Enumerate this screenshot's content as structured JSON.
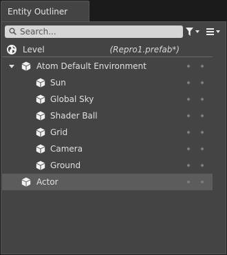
{
  "tab": {
    "title": "Entity Outliner"
  },
  "search": {
    "placeholder": "Search..."
  },
  "toolbar": {
    "filter_icon": "filter-icon",
    "menu_icon": "hamburger-menu-icon"
  },
  "level": {
    "label": "Level",
    "prefab": "(Repro1.prefab*)",
    "icon": "globe-icon"
  },
  "entities": [
    {
      "label": "Atom Default Environment",
      "depth": 0,
      "expanded": true,
      "selected": false
    },
    {
      "label": "Sun",
      "depth": 1,
      "selected": false
    },
    {
      "label": "Global Sky",
      "depth": 1,
      "selected": false
    },
    {
      "label": "Shader Ball",
      "depth": 1,
      "selected": false
    },
    {
      "label": "Grid",
      "depth": 1,
      "selected": false
    },
    {
      "label": "Camera",
      "depth": 1,
      "selected": false
    },
    {
      "label": "Ground",
      "depth": 1,
      "selected": false
    },
    {
      "label": "Actor",
      "depth": 0,
      "selected": true
    }
  ],
  "colors": {
    "panel": "#444444",
    "selected_row": "#5c5c5c",
    "search_bg": "#d6d6d6"
  }
}
